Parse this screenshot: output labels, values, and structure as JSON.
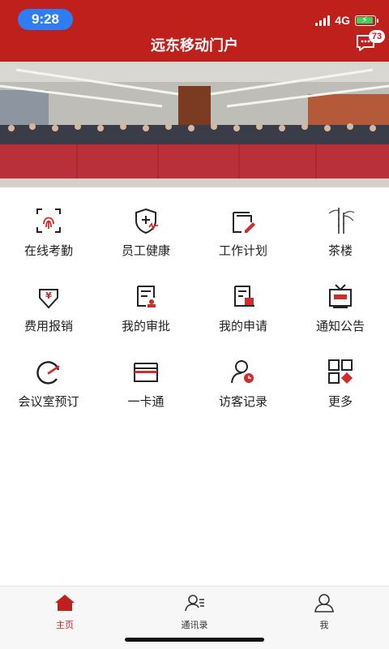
{
  "status_bar": {
    "time": "9:28",
    "network": "4G"
  },
  "header": {
    "title": "远东移动门户",
    "message_count": "73"
  },
  "banner": {
    "photo": "conference-meeting-photo"
  },
  "menu": [
    {
      "label": "在线考勤",
      "icon": "fingerprint-icon"
    },
    {
      "label": "员工健康",
      "icon": "health-shield-icon"
    },
    {
      "label": "工作计划",
      "icon": "plan-edit-icon"
    },
    {
      "label": "茶楼",
      "icon": "bamboo-painting-icon"
    },
    {
      "label": "费用报销",
      "icon": "yen-reimburse-icon"
    },
    {
      "label": "我的审批",
      "icon": "approval-doc-icon"
    },
    {
      "label": "我的申请",
      "icon": "application-doc-icon"
    },
    {
      "label": "通知公告",
      "icon": "tv-notice-icon"
    },
    {
      "label": "会议室预订",
      "icon": "meeting-gauge-icon"
    },
    {
      "label": "一卡通",
      "icon": "card-icon"
    },
    {
      "label": "访客记录",
      "icon": "visitor-record-icon"
    },
    {
      "label": "更多",
      "icon": "more-grid-icon"
    }
  ],
  "tabs": [
    {
      "label": "主页",
      "icon": "home-icon",
      "active": true
    },
    {
      "label": "通讯录",
      "icon": "contacts-icon",
      "active": false
    },
    {
      "label": "我",
      "icon": "user-icon",
      "active": false
    }
  ],
  "colors": {
    "brand_red": "#c0201c",
    "status_pill": "#2f7df3",
    "battery": "#3cd35a"
  }
}
